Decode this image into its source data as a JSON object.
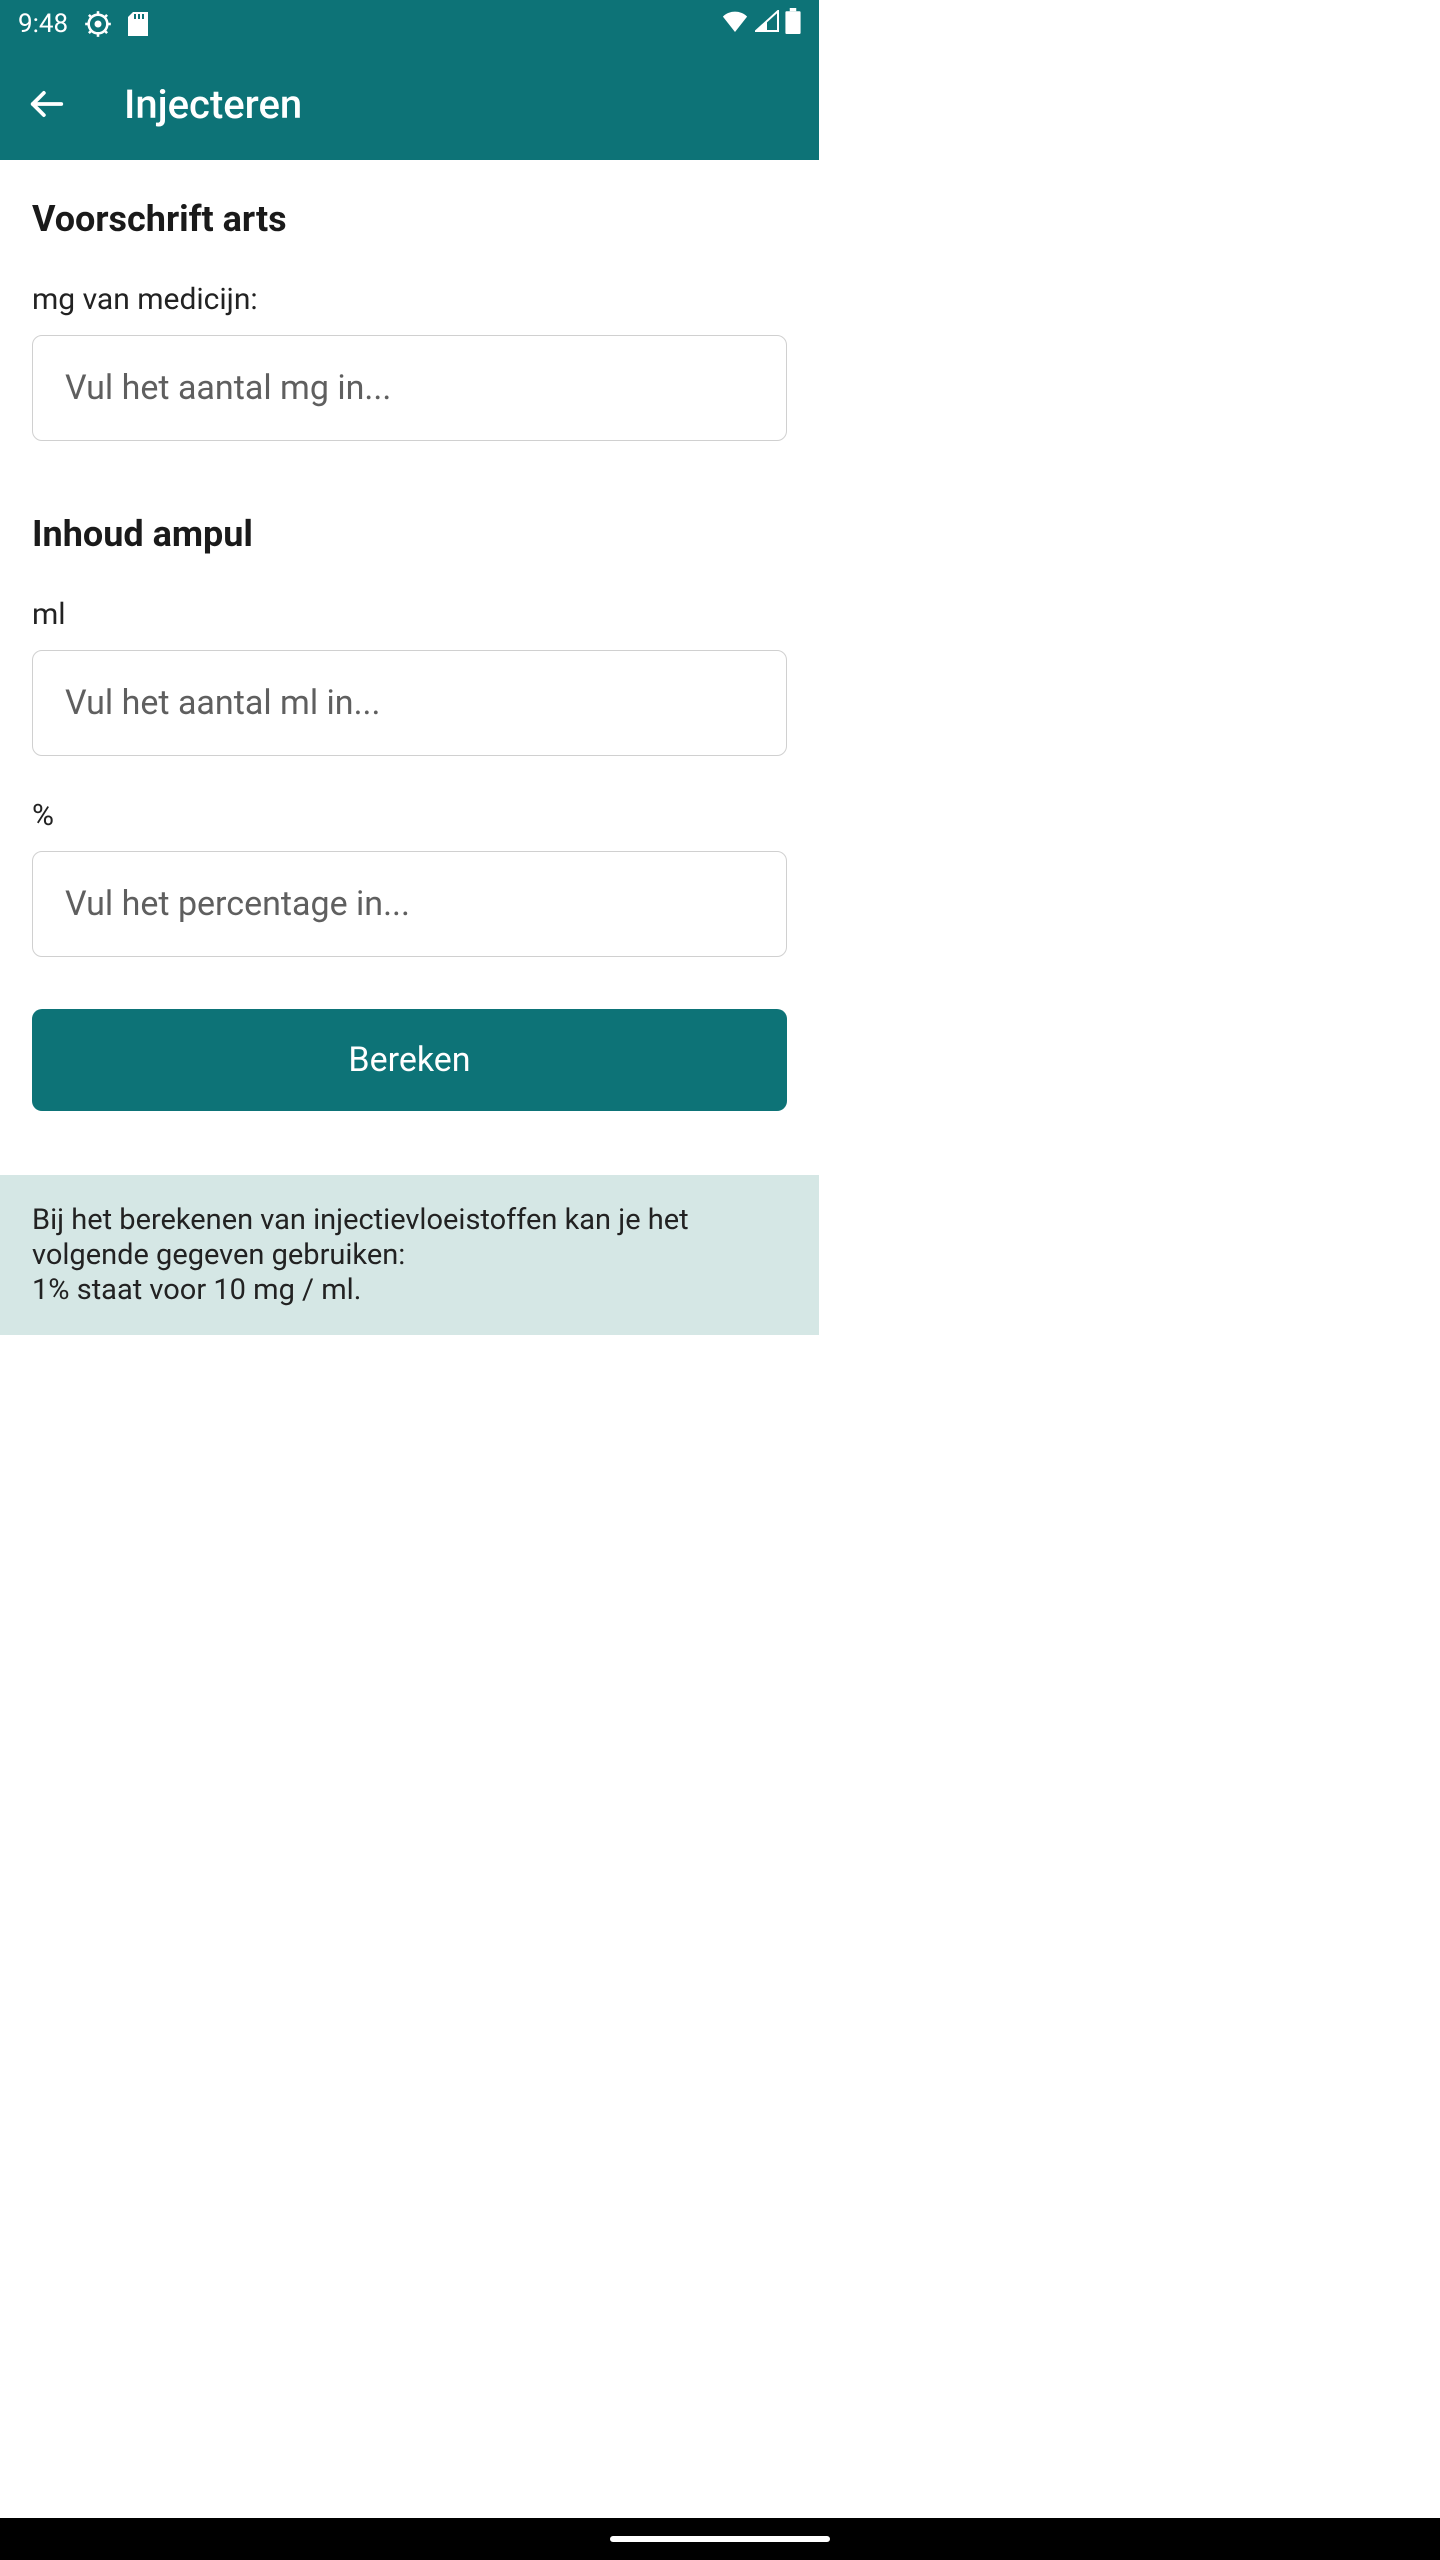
{
  "status": {
    "time": "9:48"
  },
  "appbar": {
    "title": "Injecteren"
  },
  "section1": {
    "title": "Voorschrift arts",
    "field1_label": "mg van medicijn:",
    "field1_placeholder": "Vul het aantal mg in..."
  },
  "section2": {
    "title": "Inhoud ampul",
    "field1_label": "ml",
    "field1_placeholder": "Vul het aantal ml in...",
    "field2_label": "%",
    "field2_placeholder": "Vul het percentage in..."
  },
  "button": {
    "calculate": "Bereken"
  },
  "info": {
    "text": "Bij het berekenen van injectievloeistoffen kan je het volgende gegeven gebruiken:\n1% staat voor 10 mg / ml."
  }
}
